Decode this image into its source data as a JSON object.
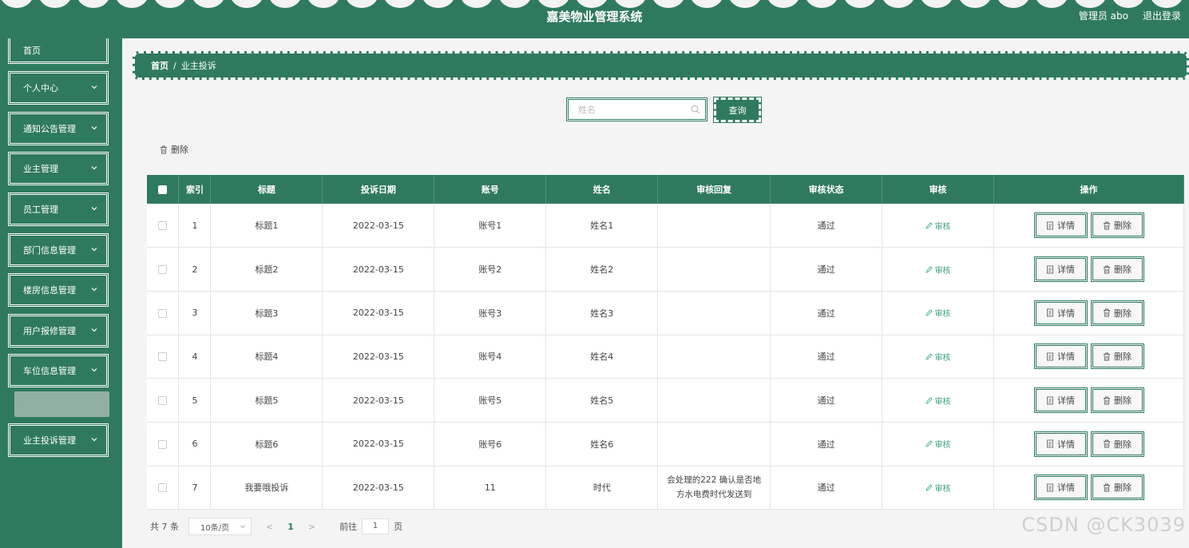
{
  "header": {
    "title": "嘉美物业管理系统",
    "admin_label": "管理员 abo",
    "logout_label": "退出登录"
  },
  "sidebar": {
    "items": [
      {
        "label": "首页"
      },
      {
        "label": "个人中心"
      },
      {
        "label": "通知公告管理"
      },
      {
        "label": "业主管理"
      },
      {
        "label": "员工管理"
      },
      {
        "label": "部门信息管理"
      },
      {
        "label": "楼房信息管理"
      },
      {
        "label": "用户报修管理"
      },
      {
        "label": "车位信息管理"
      },
      {
        "label": "业主投诉管理"
      }
    ]
  },
  "breadcrumb": {
    "home": "首页",
    "separator": "/",
    "current": "业主投诉"
  },
  "search": {
    "placeholder": "姓名",
    "value": "",
    "button_label": "查询"
  },
  "toolbar": {
    "delete_label": "删除"
  },
  "table": {
    "headers": [
      "索引",
      "标题",
      "投诉日期",
      "账号",
      "姓名",
      "审核回复",
      "审核状态",
      "审核",
      "操作"
    ],
    "audit_label": "审核",
    "detail_label": "详情",
    "delete_label": "删除",
    "rows": [
      {
        "index": "1",
        "title": "标题1",
        "date": "2022-03-15",
        "account": "账号1",
        "name": "姓名1",
        "reply": "",
        "status": "通过"
      },
      {
        "index": "2",
        "title": "标题2",
        "date": "2022-03-15",
        "account": "账号2",
        "name": "姓名2",
        "reply": "",
        "status": "通过"
      },
      {
        "index": "3",
        "title": "标题3",
        "date": "2022-03-15",
        "account": "账号3",
        "name": "姓名3",
        "reply": "",
        "status": "通过"
      },
      {
        "index": "4",
        "title": "标题4",
        "date": "2022-03-15",
        "account": "账号4",
        "name": "姓名4",
        "reply": "",
        "status": "通过"
      },
      {
        "index": "5",
        "title": "标题5",
        "date": "2022-03-15",
        "account": "账号5",
        "name": "姓名5",
        "reply": "",
        "status": "通过"
      },
      {
        "index": "6",
        "title": "标题6",
        "date": "2022-03-15",
        "account": "账号6",
        "name": "姓名6",
        "reply": "",
        "status": "通过"
      },
      {
        "index": "7",
        "title": "我要哦投诉",
        "date": "2022-03-15",
        "account": "11",
        "name": "时代",
        "reply": "会处理的222 确认是否地方水电费时代发送到",
        "status": "通过"
      }
    ]
  },
  "pagination": {
    "total": "共 7 条",
    "page_size": "10条/页",
    "current_page": "1",
    "goto_prefix": "前往",
    "goto_value": "1",
    "goto_suffix": "页"
  },
  "watermark": "CSDN @CK3039",
  "colors": {
    "primary": "#2f7a5e",
    "submenu_active": "#8fb0a2",
    "link": "#3fa07a"
  }
}
